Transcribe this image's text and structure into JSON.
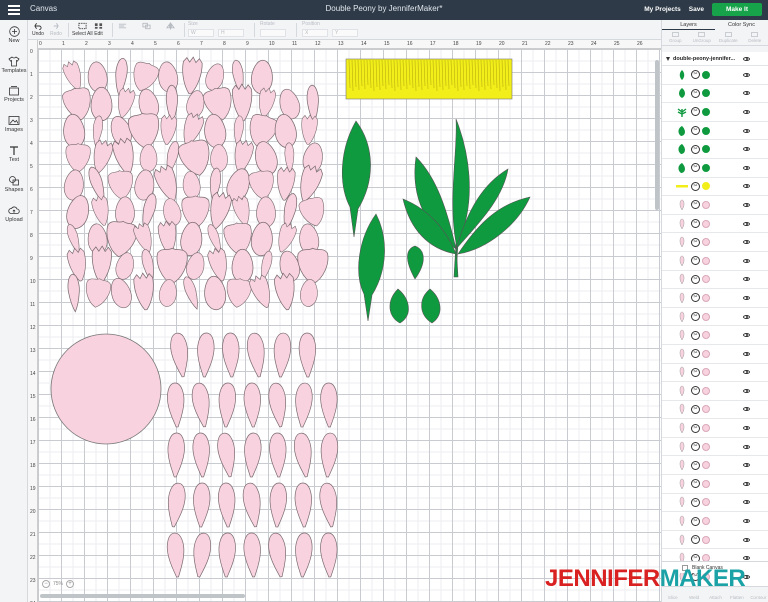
{
  "app": {
    "title": "Canvas",
    "document_title": "Double Peony by JenniferMaker*"
  },
  "topbar": {
    "my_projects": "My Projects",
    "save": "Save",
    "make_it": "Make It"
  },
  "toolbar": {
    "undo": "Undo",
    "redo": "Redo",
    "select_all": "Select All",
    "edit": "Edit",
    "size_label": "Size",
    "size_w": "W",
    "size_h": "H",
    "rotate_label": "Rotate",
    "position_label": "Position",
    "position_x": "X",
    "position_y": "Y"
  },
  "sidebar": [
    {
      "label": "New",
      "icon": "plus-icon"
    },
    {
      "label": "Templates",
      "icon": "shirt-icon"
    },
    {
      "label": "Projects",
      "icon": "projects-icon"
    },
    {
      "label": "Images",
      "icon": "image-icon"
    },
    {
      "label": "Text",
      "icon": "text-icon"
    },
    {
      "label": "Shapes",
      "icon": "shapes-icon"
    },
    {
      "label": "Upload",
      "icon": "upload-icon"
    }
  ],
  "ruler": {
    "top": [
      "0",
      "1",
      "2",
      "3",
      "4",
      "5",
      "6",
      "7",
      "8",
      "9",
      "10",
      "11",
      "12",
      "13",
      "14",
      "15",
      "16",
      "17",
      "18",
      "19",
      "20",
      "21",
      "22",
      "23",
      "24",
      "25",
      "26"
    ],
    "left": [
      "0",
      "1",
      "2",
      "3",
      "4",
      "5",
      "6",
      "7",
      "8",
      "9",
      "10",
      "11",
      "12",
      "13",
      "14",
      "15",
      "16",
      "17",
      "18",
      "19",
      "20",
      "21",
      "22",
      "23",
      "24"
    ]
  },
  "zoom": {
    "value": "75%"
  },
  "panel": {
    "tabs": [
      "Layers",
      "Color Sync"
    ],
    "actions": [
      "Group",
      "UnGroup",
      "Duplicate",
      "Delete"
    ],
    "group_name": "double-peony-jennifer...",
    "layers": [
      {
        "shape": "leaf-thin",
        "color": "#0f9a3f"
      },
      {
        "shape": "leaf-wide",
        "color": "#0f9a3f"
      },
      {
        "shape": "leaf-cluster",
        "color": "#0f9a3f"
      },
      {
        "shape": "leaf-round",
        "color": "#0f9a3f"
      },
      {
        "shape": "leaf-round",
        "color": "#0f9a3f"
      },
      {
        "shape": "leaf-round",
        "color": "#0f9a3f"
      },
      {
        "shape": "stamen",
        "color": "#f2ee1a"
      },
      {
        "shape": "petal",
        "color": "#f8d3df"
      },
      {
        "shape": "petal",
        "color": "#f8d3df"
      },
      {
        "shape": "petal",
        "color": "#f8d3df"
      },
      {
        "shape": "petal",
        "color": "#f8d3df"
      },
      {
        "shape": "petal",
        "color": "#f8d3df"
      },
      {
        "shape": "petal",
        "color": "#f8d3df"
      },
      {
        "shape": "petal",
        "color": "#f8d3df"
      },
      {
        "shape": "petal",
        "color": "#f8d3df"
      },
      {
        "shape": "petal",
        "color": "#f8d3df"
      },
      {
        "shape": "petal",
        "color": "#f8d3df"
      },
      {
        "shape": "petal",
        "color": "#f8d3df"
      },
      {
        "shape": "petal",
        "color": "#f8d3df"
      },
      {
        "shape": "petal",
        "color": "#f8d3df"
      },
      {
        "shape": "petal",
        "color": "#f8d3df"
      },
      {
        "shape": "petal",
        "color": "#f8d3df"
      },
      {
        "shape": "petal",
        "color": "#f8d3df"
      },
      {
        "shape": "petal",
        "color": "#f8d3df"
      },
      {
        "shape": "petal",
        "color": "#f8d3df"
      },
      {
        "shape": "petal",
        "color": "#f8d3df"
      },
      {
        "shape": "petal",
        "color": "#f8d3df"
      },
      {
        "shape": "petal",
        "color": "#f8d3df"
      }
    ],
    "blank_canvas": "Blank Canvas",
    "bottom_actions": [
      "Slice",
      "Weld",
      "Attach",
      "Flatten",
      "Contour"
    ]
  },
  "watermark": {
    "part1": "JENNIFER",
    "part2": "MAKER"
  },
  "colors": {
    "petal": "#f8d3df",
    "leaf": "#0f9a3f",
    "stamen": "#f2ee1a",
    "topbar": "#2e3a47",
    "make_button": "#17a34a"
  }
}
